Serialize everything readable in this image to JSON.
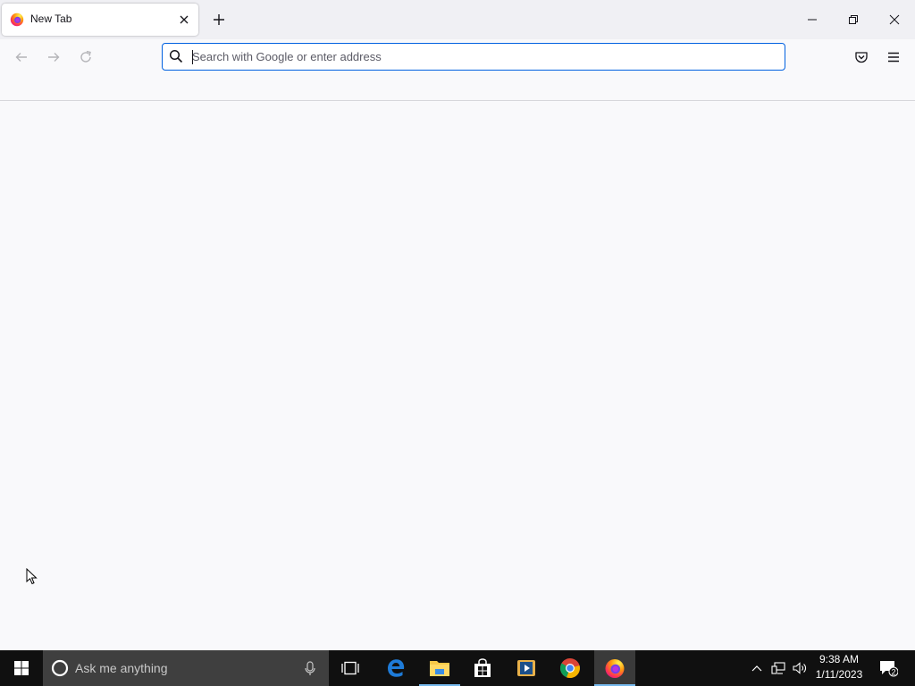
{
  "browser": {
    "tab": {
      "title": "New Tab"
    },
    "urlbar": {
      "placeholder": "Search with Google or enter address",
      "value": ""
    }
  },
  "taskbar": {
    "search_placeholder": "Ask me anything",
    "clock": {
      "time": "9:38 AM",
      "date": "1/11/2023"
    },
    "notification_count": "2"
  },
  "icons": {
    "tab": [
      "firefox-favicon-icon",
      "close-tab-icon",
      "new-tab-icon"
    ],
    "window": [
      "minimize-icon",
      "restore-icon",
      "close-window-icon"
    ],
    "nav": [
      "back-arrow-icon",
      "forward-arrow-icon",
      "reload-icon",
      "search-icon",
      "pocket-icon",
      "hamburger-menu-icon"
    ],
    "taskbar": [
      "windows-start-icon",
      "cortana-icon",
      "microphone-icon",
      "task-view-icon",
      "edge-icon",
      "file-explorer-icon",
      "store-icon",
      "media-player-icon",
      "chrome-icon",
      "firefox-icon",
      "chevron-up-icon",
      "network-icon",
      "volume-icon",
      "notification-icon"
    ]
  },
  "colors": {
    "accent": "#0061e0",
    "tabstrip_bg": "#f0f0f4",
    "content_bg": "#f9f9fb",
    "taskbar_bg": "#101010",
    "running_indicator": "#76b9ed"
  }
}
